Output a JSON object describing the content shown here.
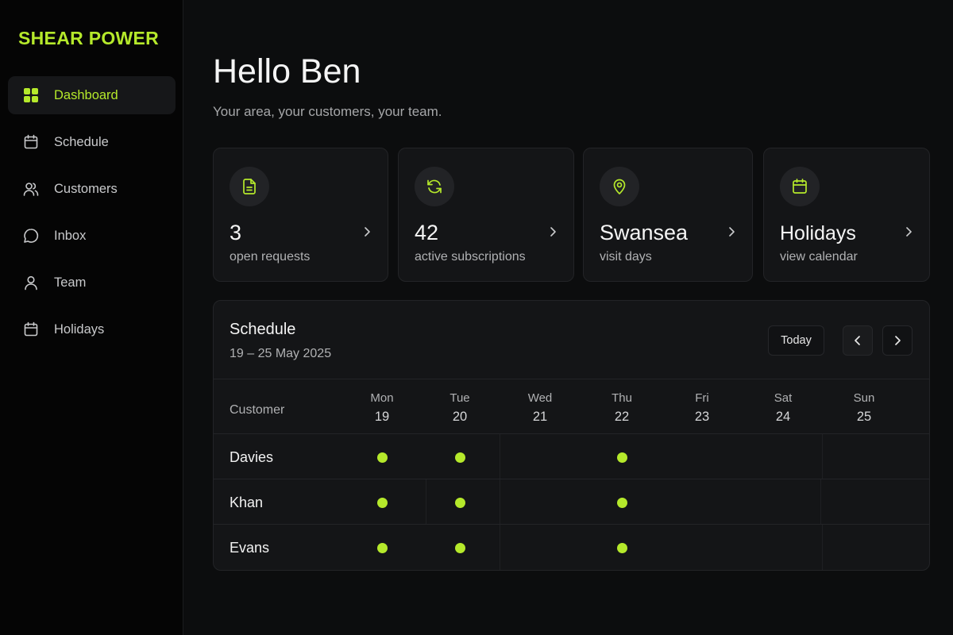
{
  "brand": {
    "name": "SHEAR POWER",
    "color": "#b5e92b"
  },
  "sidebar": {
    "items": [
      {
        "label": "Dashboard",
        "icon": "grid-icon",
        "active": true
      },
      {
        "label": "Schedule",
        "icon": "calendar-icon"
      },
      {
        "label": "Customers",
        "icon": "users-icon"
      },
      {
        "label": "Inbox",
        "icon": "chat-bubble-icon"
      },
      {
        "label": "Team",
        "icon": "user-icon"
      },
      {
        "label": "Holidays",
        "icon": "calendar-icon"
      }
    ]
  },
  "header": {
    "greeting": "Hello Ben",
    "subtitle": "Your area, your customers, your team."
  },
  "cards": [
    {
      "value": "3",
      "label": "open requests",
      "icon": "document-icon"
    },
    {
      "value": "42",
      "label": "active subscriptions",
      "icon": "refresh-icon"
    },
    {
      "value": "Swansea",
      "label": "visit days",
      "icon": "map-pin-icon"
    },
    {
      "value": "Holidays",
      "label": "view calendar",
      "icon": "calendar-icon"
    }
  ],
  "schedule": {
    "title": "Schedule",
    "range": "19 – 25 May 2025",
    "today_label": "Today",
    "customer_header": "Customer",
    "days": [
      {
        "name": "Mon",
        "date": "19"
      },
      {
        "name": "Tue",
        "date": "20"
      },
      {
        "name": "Wed",
        "date": "21"
      },
      {
        "name": "Thu",
        "date": "22"
      },
      {
        "name": "Fri",
        "date": "23"
      },
      {
        "name": "Sat",
        "date": "24"
      },
      {
        "name": "Sun",
        "date": "25"
      }
    ],
    "rows": [
      {
        "name": "Davies",
        "visits": [
          true,
          true,
          false,
          true,
          false,
          false,
          false
        ]
      },
      {
        "name": "Khan",
        "visits": [
          true,
          true,
          false,
          true,
          false,
          false,
          false
        ]
      },
      {
        "name": "Evans",
        "visits": [
          true,
          true,
          false,
          true,
          false,
          false,
          false
        ]
      }
    ]
  }
}
